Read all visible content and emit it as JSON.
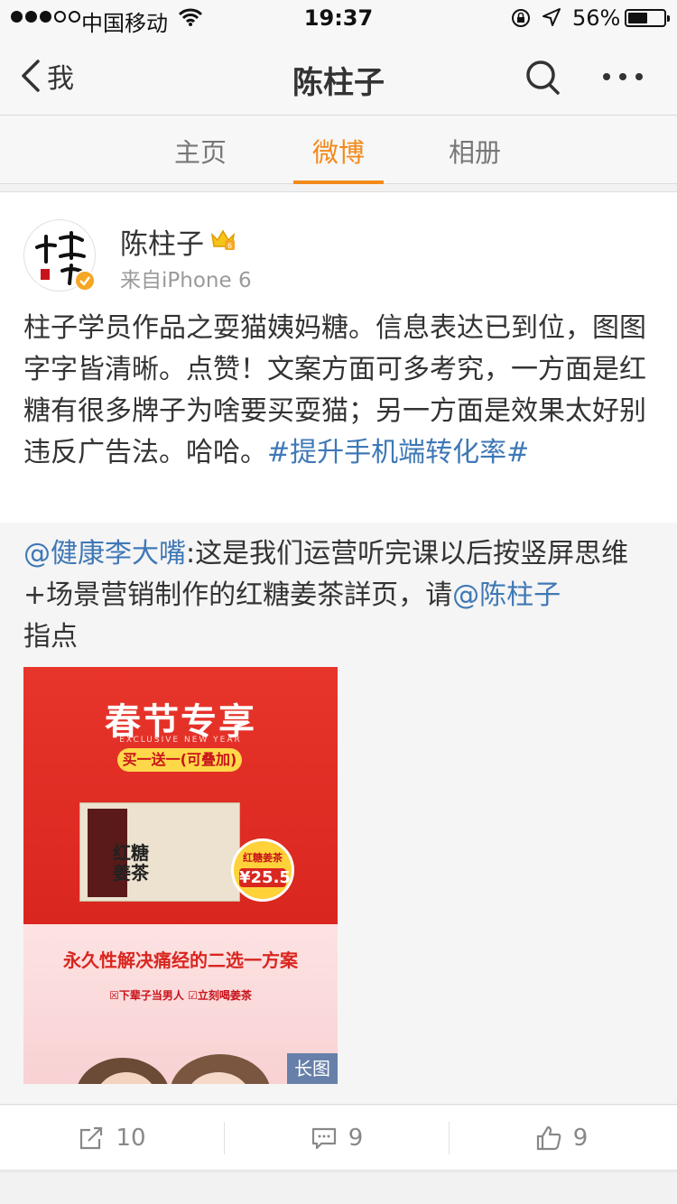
{
  "status_bar": {
    "carrier": "中国移动",
    "time": "19:37",
    "battery_percent": "56%",
    "battery_level": 0.56
  },
  "nav": {
    "back_label": "我",
    "title": "陈柱子"
  },
  "tabs": [
    {
      "label": "主页",
      "active": false
    },
    {
      "label": "微博",
      "active": true
    },
    {
      "label": "相册",
      "active": false
    }
  ],
  "post": {
    "author": "陈柱子",
    "source": "来自iPhone 6",
    "text": "柱子学员作品之耍猫姨妈糖。信息表达已到位，图图字字皆清晰。点赞！文案方面可多考究，一方面是红糖有很多牌子为啥要买耍猫；另一方面是效果太好别违反广告法。哈哈。",
    "hashtag": "#提升手机端转化率#",
    "repost": {
      "mention": "@健康李大嘴",
      "text": ":这是我们运营听完课以后按竖屏思维+场景营销制作的红糖姜茶詳页，请",
      "mention2": "@陈柱子",
      "tail": "指点"
    },
    "image": {
      "title": "春节专享",
      "subtitle": "EXCLUSIVE NEW YEAR",
      "promo": "买一送一(可叠加)",
      "product_label": "红糖姜茶",
      "price_tag": "红糖姜茶",
      "price": "¥25.5",
      "slogan": "永久性解决痛经的二选一方案",
      "options": "☒下辈子当男人  ☑立刻喝姜茶",
      "long_image_badge": "长图"
    }
  },
  "actions": {
    "repost_count": "10",
    "comment_count": "9",
    "like_count": "9"
  }
}
